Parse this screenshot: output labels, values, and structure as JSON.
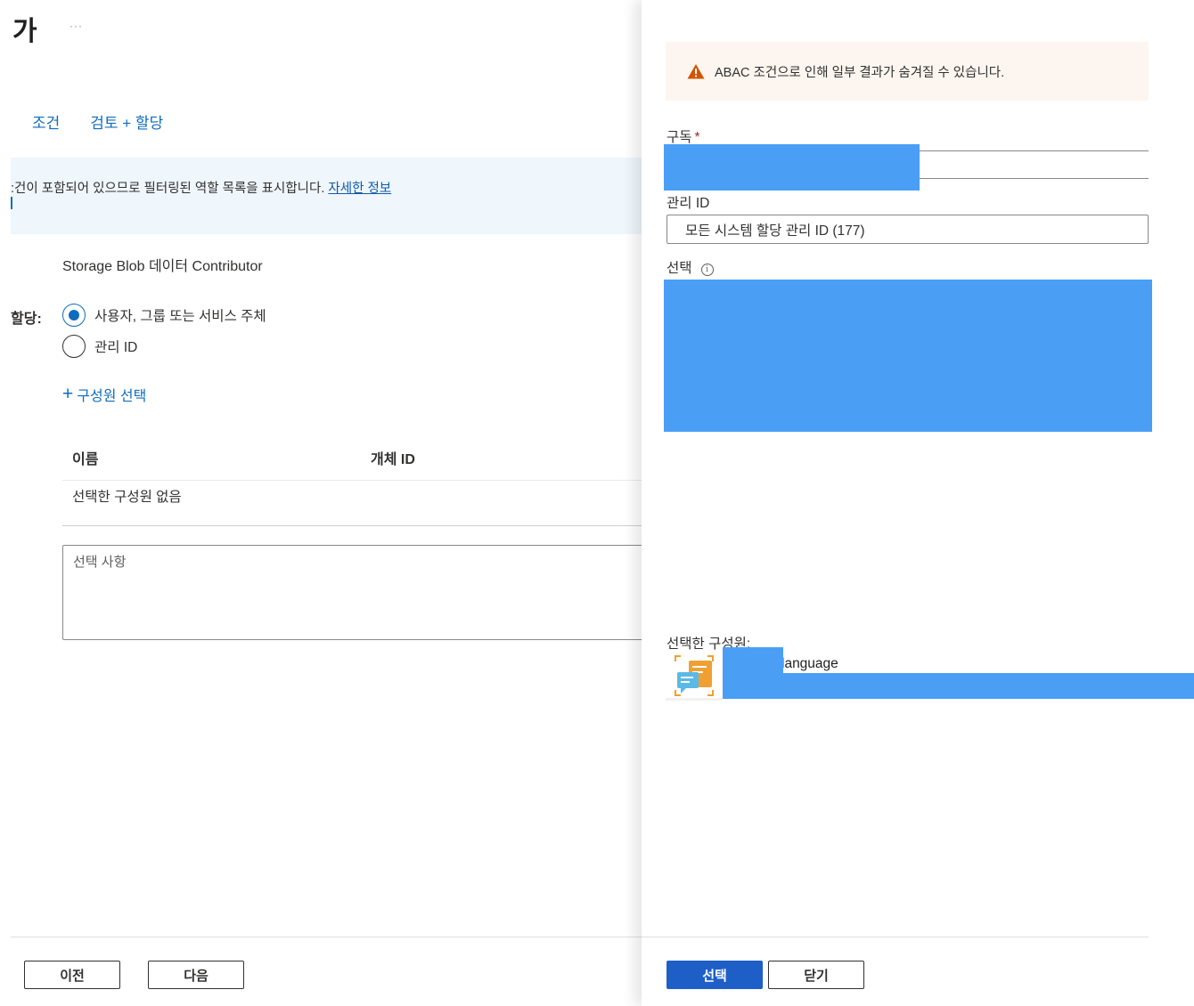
{
  "header": {
    "title": "가",
    "more": "···"
  },
  "tabs": [
    {
      "label": "조건"
    },
    {
      "label": "검토 + 할당"
    }
  ],
  "info_banner": {
    "text": ":건이 포함되어 있으므로 필터링된 역할 목록을 표시합니다.",
    "link": "자세한 정보"
  },
  "role": {
    "value": "Storage Blob 데이터 Contributor"
  },
  "assign": {
    "label": "할당:",
    "options": [
      {
        "label": "사용자, 그룹 또는 서비스 주체",
        "checked": true
      },
      {
        "label": "관리 ID",
        "checked": false
      }
    ]
  },
  "add_member": {
    "label": "구성원 선택"
  },
  "members_table": {
    "columns": [
      "이름",
      "개체 ID"
    ],
    "empty": "선택한 구성원 없음"
  },
  "description": {
    "placeholder": "선택 사항"
  },
  "footer_left": {
    "prev": "이전",
    "next": "다음"
  },
  "panel": {
    "warning": "ABAC 조건으로 인해 일부 결과가 숨겨질 수 있습니다.",
    "subscription_label": "구독",
    "required_mark": "*",
    "managed_id_label": "관리 ID",
    "managed_id_value": "모든 시스템 할당 관리 ID (177)",
    "select_label": "선택",
    "info_glyph": "i",
    "selected_members_label": "선택한 구성원:",
    "member_name": "language",
    "select_button": "선택",
    "close_button": "닫기"
  },
  "colors": {
    "accent": "#0f6cbd",
    "primary_button": "#1e5fc7",
    "warning": "#d35400",
    "redaction": "#4a9ff5"
  }
}
